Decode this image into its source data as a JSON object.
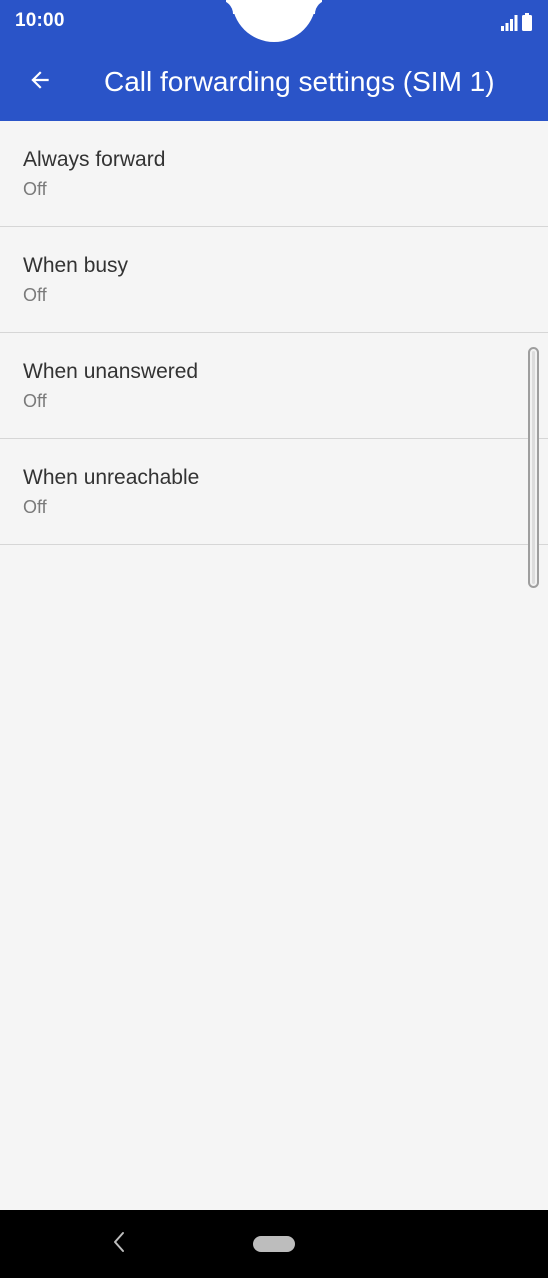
{
  "status_bar": {
    "time": "10:00",
    "icons": [
      "signal-icon",
      "battery-icon"
    ]
  },
  "app_bar": {
    "title": "Call forwarding settings (SIM 1)",
    "back_icon": "arrow-back-icon",
    "color": "#2a54c8"
  },
  "settings": {
    "items": [
      {
        "title": "Always forward",
        "summary": "Off"
      },
      {
        "title": "When busy",
        "summary": "Off"
      },
      {
        "title": "When unanswered",
        "summary": "Off"
      },
      {
        "title": "When unreachable",
        "summary": "Off"
      }
    ]
  },
  "nav_bar": {
    "icons": [
      "nav-back-icon",
      "home-pill-icon"
    ]
  }
}
